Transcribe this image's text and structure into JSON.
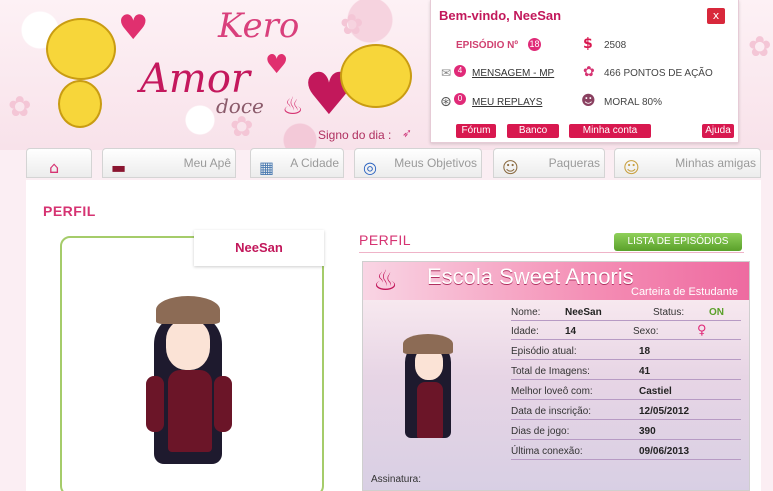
{
  "header": {
    "logo": {
      "line1": "Kero",
      "line2": "Amor",
      "line3": "doce"
    },
    "signo_label": "Signo do dia :",
    "signo_icon": "sagittarius-icon"
  },
  "user_panel": {
    "welcome": "Bem-vindo, NeeSan",
    "close_label": "x",
    "episode_label": "EPISÓDIO Nº",
    "episode_number": "18",
    "money_icon": "dollar-icon",
    "money": "2508",
    "messages_count": "4",
    "messages_label": "MENSAGEM - MP",
    "action_points": "466 PONTOS DE AÇÃO",
    "replays_count": "0",
    "replays_label": "MEU REPLAYS",
    "moral": "MORAL 80%",
    "buttons": {
      "forum": "Fórum",
      "bank": "Banco",
      "account": "Minha conta"
    },
    "help": "Ajuda"
  },
  "nav": {
    "tabs": [
      {
        "label": "",
        "icon": "home-icon"
      },
      {
        "label": "Meu Apê",
        "icon": "sofa-icon"
      },
      {
        "label": "A Cidade",
        "icon": "building-icon"
      },
      {
        "label": "Meus Objetivos",
        "icon": "target-icon"
      },
      {
        "label": "Paqueras",
        "icon": "boy-icon"
      },
      {
        "label": "Minhas amigas",
        "icon": "girl-icon"
      }
    ]
  },
  "main": {
    "page_title": "PERFIL",
    "avatar_name": "NeeSan",
    "section_title": "PERFIL",
    "list_button": "LISTA DE EPISÓDIOS",
    "card": {
      "school": "Escola Sweet Amoris",
      "subtitle": "Carteira de Estudante",
      "rows": [
        {
          "label": "Nome:",
          "value": "NeeSan"
        },
        {
          "label": "Idade:",
          "value": "14"
        },
        {
          "label": "Episódio atual:",
          "value": "18"
        },
        {
          "label": "Total de Imagens:",
          "value": "41"
        },
        {
          "label": "Melhor loveô com:",
          "value": "Castiel"
        },
        {
          "label": "Data de inscrição:",
          "value": "12/05/2012"
        },
        {
          "label": "Dias de jogo:",
          "value": "390"
        },
        {
          "label": "Última conexão:",
          "value": "09/06/2013"
        }
      ],
      "status_label": "Status:",
      "status_value": "ON",
      "sexo_label": "Sexo:",
      "sexo_value": "♀",
      "signature_label": "Assinatura:"
    }
  }
}
